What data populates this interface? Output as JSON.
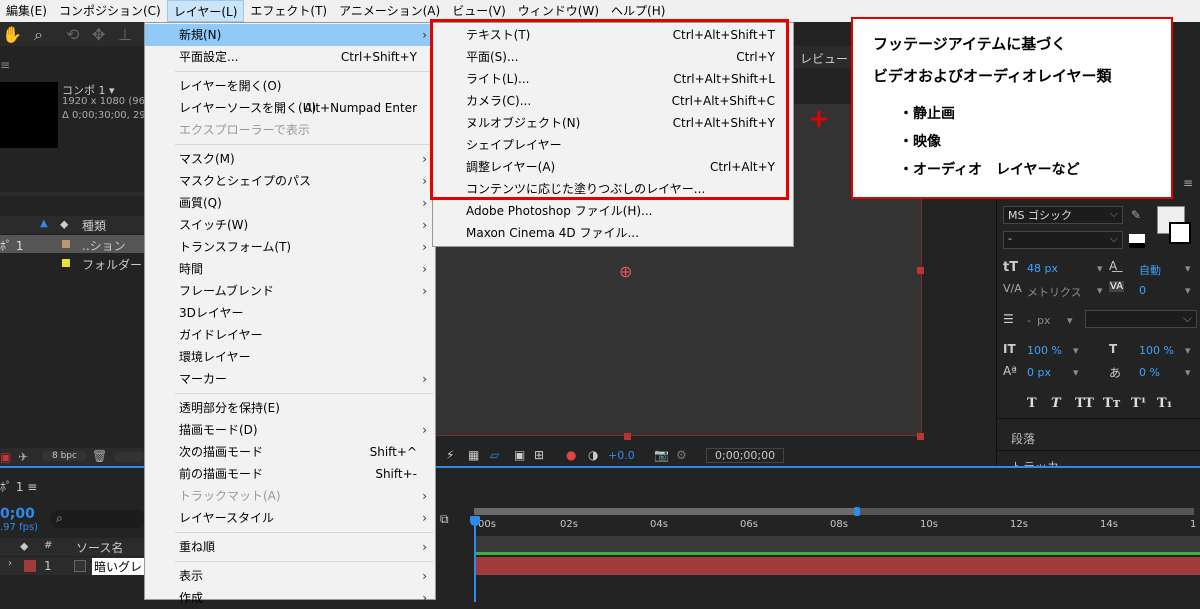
{
  "menubar": [
    "編集(E)",
    "コンポジション(C)",
    "レイヤー(L)",
    "エフェクト(T)",
    "アニメーション(A)",
    "ビュー(V)",
    "ウィンドウ(W)",
    "ヘルプ(H)"
  ],
  "project": {
    "comp_name": "コンポ 1 ▾",
    "comp_size": "1920 x 1080  (96",
    "comp_dur": "Δ 0;00;30;00, 29.",
    "col_type": "種類",
    "row1_name": "ﾎﾟ 1",
    "row1_type": "..ション",
    "row2_type": "フォルダー",
    "bpc": "8 bpc"
  },
  "timeline": {
    "tab": "ﾎﾟ 1  ≡",
    "time": "0;00",
    "fps": ".97 fps)",
    "col_num": "#",
    "col_source": "ソース名",
    "layer_num": "1",
    "layer_name": "暗いグレ",
    "ticks": [
      "00s",
      "02s",
      "04s",
      "06s",
      "08s",
      "10s",
      "12s",
      "14s",
      "1"
    ]
  },
  "viewer": {
    "tab_review": "レビュー",
    "exposure": "+0.0",
    "timecode": "0;00;00;00"
  },
  "layer_menu": {
    "items": [
      {
        "label": "新規(N)",
        "shortcut": "",
        "arrow": true,
        "highlight": true
      },
      {
        "label": "平面設定...",
        "shortcut": "Ctrl+Shift+Y"
      },
      {
        "sep": true
      },
      {
        "label": "レイヤーを開く(O)",
        "shortcut": ""
      },
      {
        "label": "レイヤーソースを開く(U)",
        "shortcut": "Alt+Numpad Enter"
      },
      {
        "label": "エクスプローラーで表示",
        "shortcut": "",
        "disabled": true
      },
      {
        "sep": true
      },
      {
        "label": "マスク(M)",
        "arrow": true
      },
      {
        "label": "マスクとシェイプのパス",
        "arrow": true
      },
      {
        "label": "画質(Q)",
        "arrow": true
      },
      {
        "label": "スイッチ(W)",
        "arrow": true
      },
      {
        "label": "トランスフォーム(T)",
        "arrow": true
      },
      {
        "label": "時間",
        "arrow": true
      },
      {
        "label": "フレームブレンド",
        "arrow": true
      },
      {
        "label": "3Dレイヤー"
      },
      {
        "label": "ガイドレイヤー"
      },
      {
        "label": "環境レイヤー"
      },
      {
        "label": "マーカー",
        "arrow": true
      },
      {
        "sep": true
      },
      {
        "label": "透明部分を保持(E)"
      },
      {
        "label": "描画モード(D)",
        "arrow": true
      },
      {
        "label": "次の描画モード",
        "shortcut": "Shift+^"
      },
      {
        "label": "前の描画モード",
        "shortcut": "Shift+-"
      },
      {
        "label": "トラックマット(A)",
        "arrow": true,
        "disabled": true
      },
      {
        "label": "レイヤースタイル",
        "arrow": true
      },
      {
        "sep": true
      },
      {
        "label": "重ね順",
        "arrow": true
      },
      {
        "sep": true
      },
      {
        "label": "表示",
        "arrow": true
      },
      {
        "label": "作成",
        "arrow": true
      }
    ]
  },
  "new_submenu": {
    "items": [
      {
        "label": "テキスト(T)",
        "shortcut": "Ctrl+Alt+Shift+T"
      },
      {
        "label": "平面(S)...",
        "shortcut": "Ctrl+Y"
      },
      {
        "label": "ライト(L)...",
        "shortcut": "Ctrl+Alt+Shift+L"
      },
      {
        "label": "カメラ(C)...",
        "shortcut": "Ctrl+Alt+Shift+C"
      },
      {
        "label": "ヌルオブジェクト(N)",
        "shortcut": "Ctrl+Alt+Shift+Y"
      },
      {
        "label": "シェイプレイヤー",
        "shortcut": ""
      },
      {
        "label": "調整レイヤー(A)",
        "shortcut": "Ctrl+Alt+Y"
      },
      {
        "label": "コンテンツに応じた塗りつぶしのレイヤー...",
        "shortcut": ""
      },
      {
        "label": "Adobe Photoshop ファイル(H)...",
        "shortcut": ""
      },
      {
        "label": "Maxon Cinema 4D ファイル...",
        "shortcut": ""
      }
    ]
  },
  "note": {
    "line1": "フッテージアイテムに基づく",
    "line2": "ビデオおよびオーディオレイヤー類",
    "bullet1": "・静止画",
    "bullet2": "・映像",
    "bullet3": "・オーディオ　レイヤーなど"
  },
  "character": {
    "font": "MS ゴシック",
    "style": "-",
    "size": "48 px",
    "leading": "自動",
    "kerning": "メトリクス",
    "tracking": "0",
    "stroke": "-",
    "stroke_unit": "px",
    "vscale": "100 %",
    "hscale": "100 %",
    "baseline": "0 px",
    "tsume": "0 %",
    "styles": [
      "T",
      "T",
      "TT",
      "Tт",
      "T¹",
      "T₁"
    ],
    "paragraph": "段落",
    "tracker": "トラッカー"
  },
  "colors": {
    "accent": "#2d8ceb",
    "annotation": "#e60000",
    "highlight": "#91c9f7",
    "layer_bar": "#a13a3a"
  }
}
